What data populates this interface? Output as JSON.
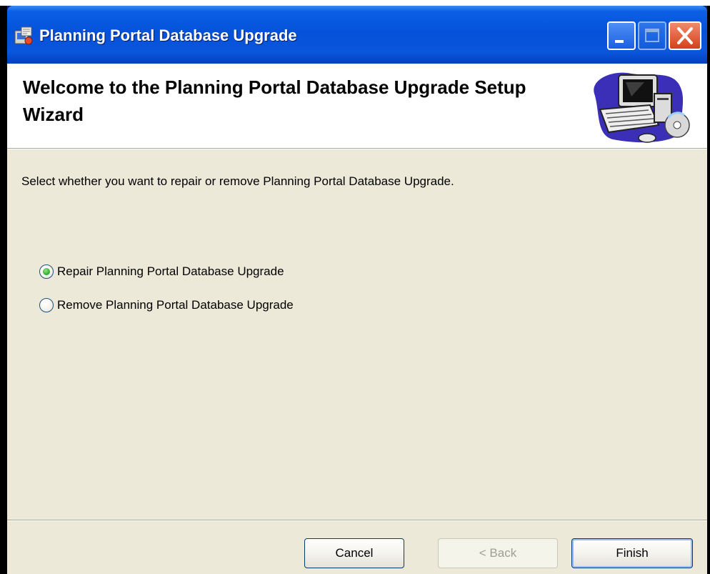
{
  "window": {
    "title": "Planning Portal Database Upgrade",
    "app_icon": "installer-icon",
    "controls": {
      "minimize": "minimize-icon",
      "maximize": "maximize-icon",
      "close": "close-icon"
    }
  },
  "banner": {
    "heading": "Welcome to the Planning Portal Database Upgrade Setup Wizard",
    "graphic": "computer-cd-icon"
  },
  "body": {
    "instruction": "Select whether you want to repair or remove Planning Portal Database Upgrade.",
    "options": [
      {
        "label": "Repair Planning Portal Database Upgrade",
        "selected": true
      },
      {
        "label": "Remove Planning Portal Database Upgrade",
        "selected": false
      }
    ]
  },
  "footer": {
    "cancel_label": "Cancel",
    "back_label": "< Back",
    "back_enabled": false,
    "finish_label": "Finish"
  },
  "colors": {
    "titlebar": "#0552d9",
    "dialog_bg": "#ece9d8",
    "radio_selected": "#3fb53a",
    "close_button": "#d6401c"
  }
}
